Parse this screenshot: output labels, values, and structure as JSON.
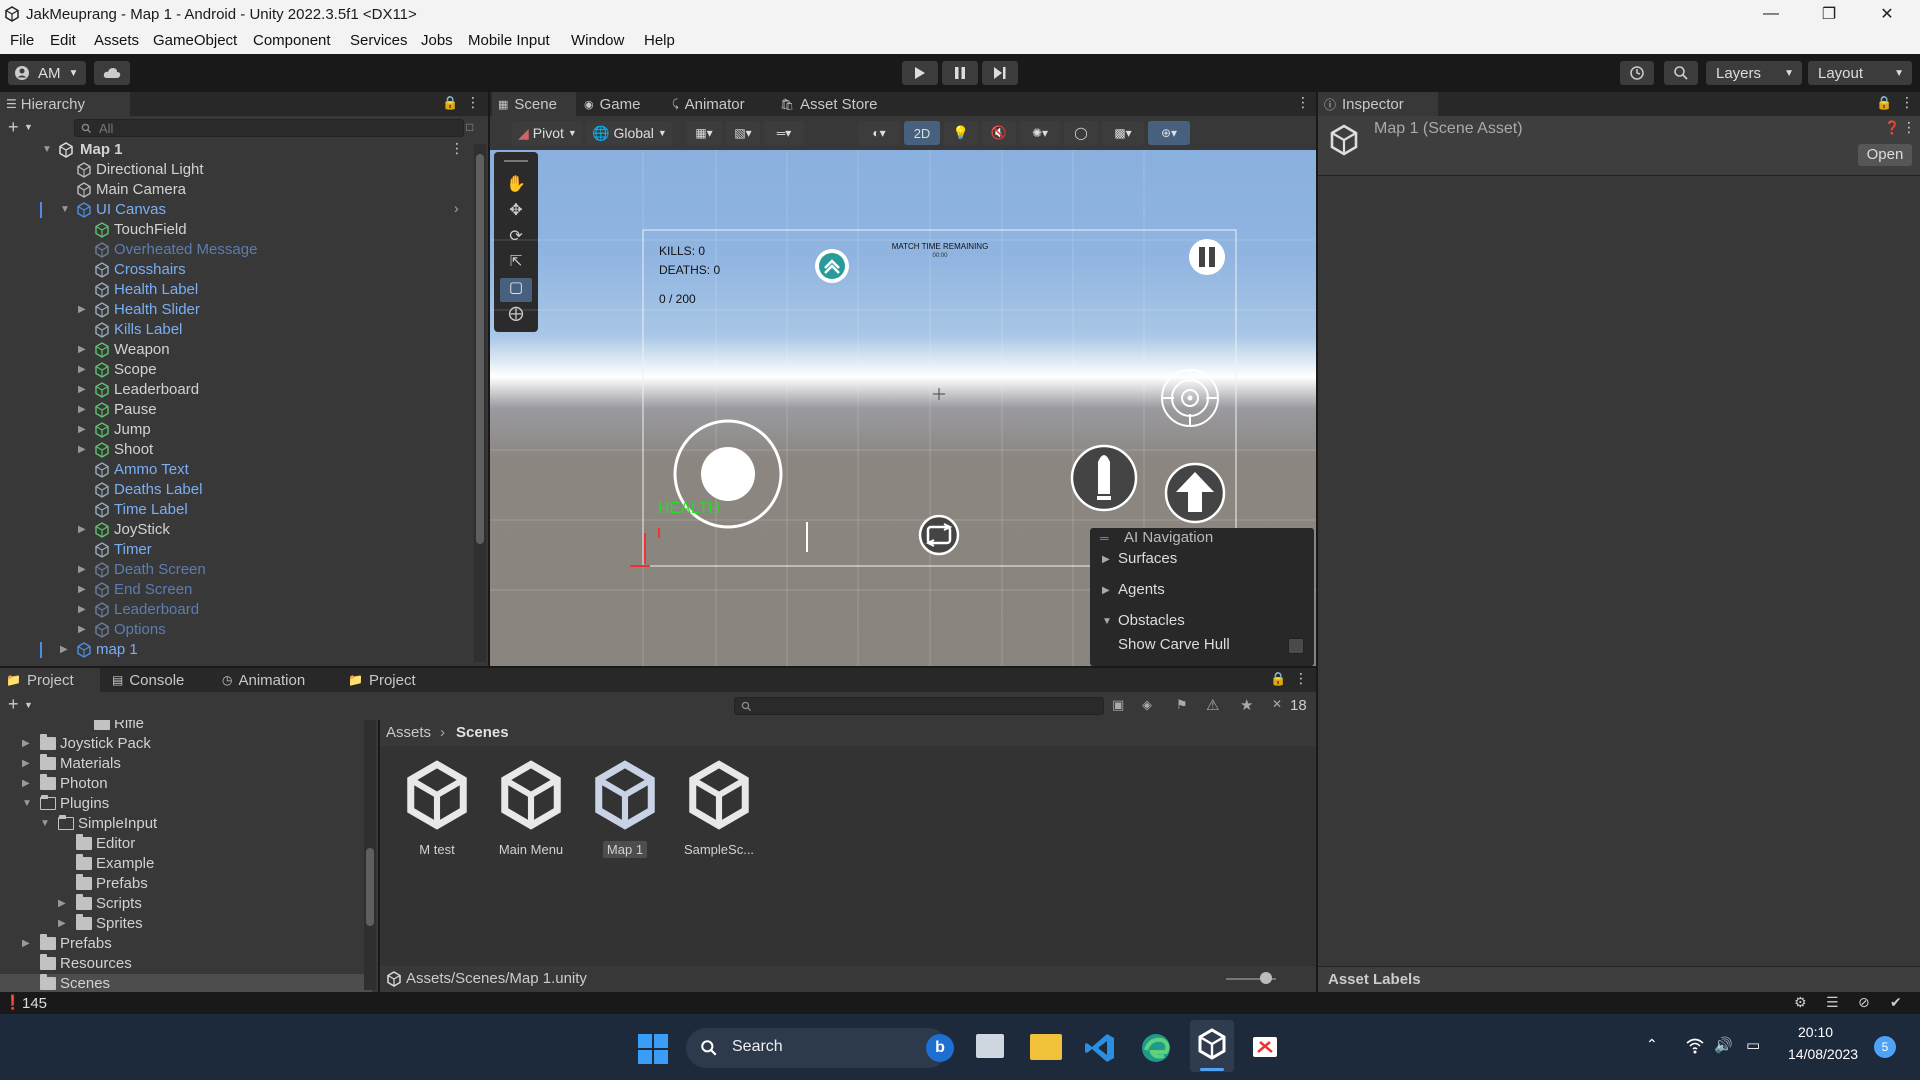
{
  "window": {
    "title": "JakMeuprang - Map 1 - Android - Unity 2022.3.5f1 <DX11>",
    "controls": [
      "minimize",
      "restore",
      "close"
    ]
  },
  "menu": [
    "File",
    "Edit",
    "Assets",
    "GameObject",
    "Component",
    "Services",
    "Jobs",
    "Mobile Input",
    "Window",
    "Help"
  ],
  "toolbar": {
    "account": "AM",
    "layers": "Layers",
    "layout": "Layout"
  },
  "hierarchy": {
    "tab": "Hierarchy",
    "search_placeholder": "All",
    "scene": "Map 1",
    "items": [
      {
        "label": "Directional Light"
      },
      {
        "label": "Main Camera"
      },
      {
        "label": "UI Canvas"
      },
      {
        "label": "TouchField"
      },
      {
        "label": "Overheated Message"
      },
      {
        "label": "Crosshairs"
      },
      {
        "label": "Health Label"
      },
      {
        "label": "Health Slider"
      },
      {
        "label": "Kills Label"
      },
      {
        "label": "Weapon"
      },
      {
        "label": "Scope"
      },
      {
        "label": "Leaderboard"
      },
      {
        "label": "Pause"
      },
      {
        "label": "Jump"
      },
      {
        "label": "Shoot"
      },
      {
        "label": "Ammo Text"
      },
      {
        "label": "Deaths Label"
      },
      {
        "label": "Time Label"
      },
      {
        "label": "JoyStick"
      },
      {
        "label": "Timer"
      },
      {
        "label": "Death Screen"
      },
      {
        "label": "End Screen"
      },
      {
        "label": "Leaderboard"
      },
      {
        "label": "Options"
      },
      {
        "label": "map 1"
      }
    ]
  },
  "scene_tabs": [
    "Scene",
    "Game",
    "Animator",
    "Asset Store"
  ],
  "scene_toolbar": {
    "pivot": "Pivot",
    "global": "Global",
    "mode2d": "2D"
  },
  "game_ui": {
    "kills": "KILLS: 0",
    "deaths": "DEATHS: 0",
    "ammo": "0 / 200",
    "match_time": "MATCH TIME REMAINING",
    "match_time_value": "00:00",
    "health": "HEALTH"
  },
  "ai_nav": {
    "title": "AI Navigation",
    "surfaces": "Surfaces",
    "agents": "Agents",
    "obstacles": "Obstacles",
    "show_carve_hull": "Show Carve Hull"
  },
  "inspector": {
    "tab": "Inspector",
    "asset_name": "Map 1 (Scene Asset)",
    "open": "Open",
    "asset_labels": "Asset Labels"
  },
  "project": {
    "tabs": [
      "Project",
      "Console",
      "Animation",
      "Project"
    ],
    "hidden_count": "18",
    "breadcrumb": [
      "Assets",
      "Scenes"
    ],
    "tree": [
      {
        "label": "Rifle"
      },
      {
        "label": "Joystick Pack"
      },
      {
        "label": "Materials"
      },
      {
        "label": "Photon"
      },
      {
        "label": "Plugins"
      },
      {
        "label": "SimpleInput"
      },
      {
        "label": "Editor"
      },
      {
        "label": "Example"
      },
      {
        "label": "Prefabs"
      },
      {
        "label": "Scripts"
      },
      {
        "label": "Sprites"
      },
      {
        "label": "Prefabs"
      },
      {
        "label": "Resources"
      },
      {
        "label": "Scenes"
      }
    ],
    "assets": [
      {
        "label": "M test"
      },
      {
        "label": "Main Menu"
      },
      {
        "label": "Map 1"
      },
      {
        "label": "SampleSc..."
      }
    ],
    "path": "Assets/Scenes/Map 1.unity"
  },
  "status": {
    "count": "145"
  },
  "taskbar": {
    "search": "Search",
    "time": "20:10",
    "date": "14/08/2023",
    "notifications": "5"
  },
  "colors": {
    "accent_blue": "#7aaef5",
    "dim_blue": "#5b7db0",
    "health_green": "#22dd22"
  }
}
